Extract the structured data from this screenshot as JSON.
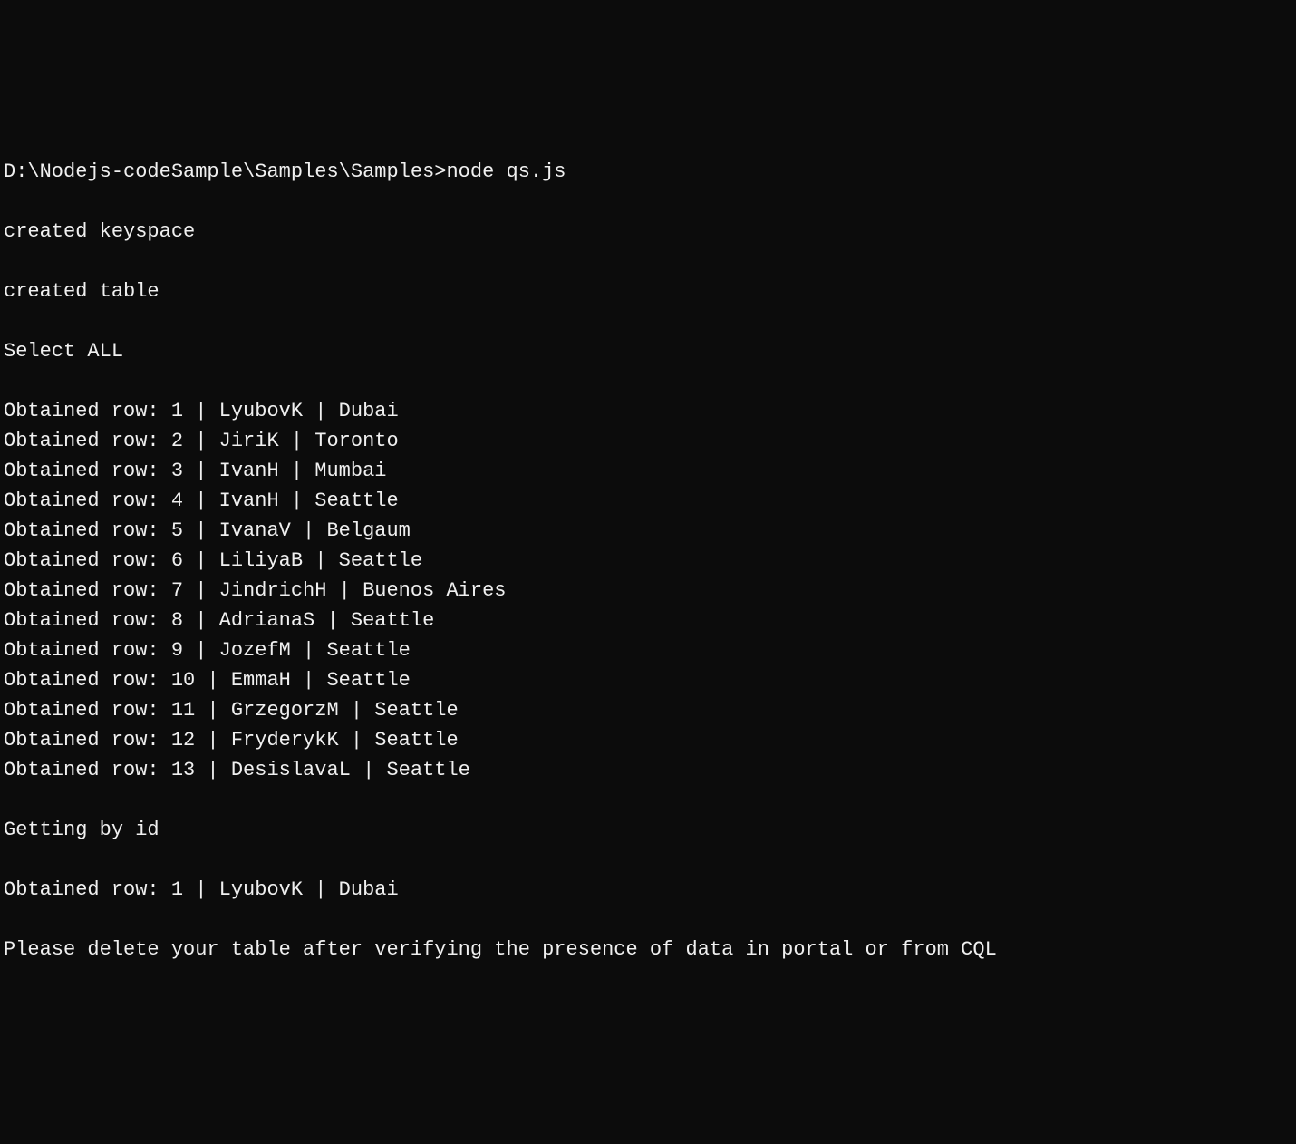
{
  "terminal": {
    "prompt": "D:\\Nodejs-codeSample\\Samples\\Samples>",
    "command": "node qs.js",
    "output": {
      "created_keyspace": "created keyspace",
      "created_table": "created table",
      "select_all": "Select ALL",
      "rows": [
        {
          "id": "1",
          "name": "LyubovK",
          "city": "Dubai"
        },
        {
          "id": "2",
          "name": "JiriK",
          "city": "Toronto"
        },
        {
          "id": "3",
          "name": "IvanH",
          "city": "Mumbai"
        },
        {
          "id": "4",
          "name": "IvanH",
          "city": "Seattle"
        },
        {
          "id": "5",
          "name": "IvanaV",
          "city": "Belgaum"
        },
        {
          "id": "6",
          "name": "LiliyaB",
          "city": "Seattle"
        },
        {
          "id": "7",
          "name": "JindrichH",
          "city": "Buenos Aires"
        },
        {
          "id": "8",
          "name": "AdrianaS",
          "city": "Seattle"
        },
        {
          "id": "9",
          "name": "JozefM",
          "city": "Seattle"
        },
        {
          "id": "10",
          "name": "EmmaH",
          "city": "Seattle"
        },
        {
          "id": "11",
          "name": "GrzegorzM",
          "city": "Seattle"
        },
        {
          "id": "12",
          "name": "FryderykK",
          "city": "Seattle"
        },
        {
          "id": "13",
          "name": "DesislavaL",
          "city": "Seattle"
        }
      ],
      "getting_by_id": "Getting by id",
      "by_id_row": {
        "id": "1",
        "name": "LyubovK",
        "city": "Dubai"
      },
      "footer": "Please delete your table after verifying the presence of data in portal or from CQL"
    }
  }
}
